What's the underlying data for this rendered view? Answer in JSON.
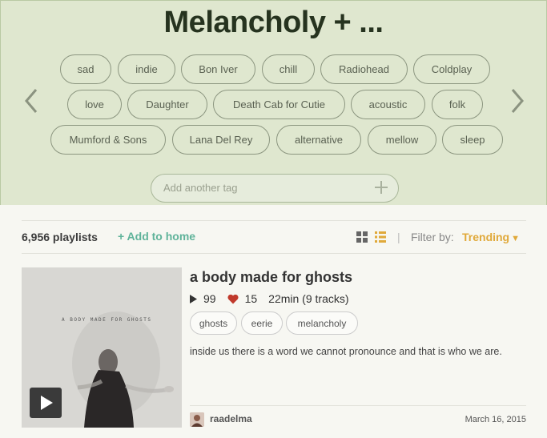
{
  "header": {
    "title": "Melancholy + ...",
    "tags": [
      "sad",
      "indie",
      "Bon Iver",
      "chill",
      "Radiohead",
      "Coldplay",
      "love",
      "Daughter",
      "Death Cab for Cutie",
      "acoustic",
      "folk",
      "Mumford & Sons",
      "Lana Del Rey",
      "alternative",
      "mellow",
      "sleep"
    ],
    "add_tag_placeholder": "Add another tag",
    "prev_icon": "chevron-left-icon",
    "next_icon": "chevron-right-icon",
    "add_icon": "plus-icon"
  },
  "toolbar": {
    "count": "6,956 playlists",
    "add_home": "+ Add to home",
    "separator": "|",
    "filter_label": "Filter by:",
    "filter_value": "Trending",
    "filter_caret": "▼"
  },
  "playlist": {
    "title": "a body made for ghosts",
    "cover_text": "A BODY MADE FOR GHOSTS",
    "plays": "99",
    "likes": "15",
    "duration": "22min (9 tracks)",
    "tags": [
      "ghosts",
      "eerie",
      "melancholy"
    ],
    "description": "inside us there is a word we cannot pronounce and that is who we are.",
    "author": "raadelma",
    "date": "March 16, 2015"
  },
  "colors": {
    "hero_bg": "#dfe7cf",
    "accent_green": "#5fb39a",
    "accent_orange": "#e0a93a",
    "heart_red": "#c0392b"
  }
}
